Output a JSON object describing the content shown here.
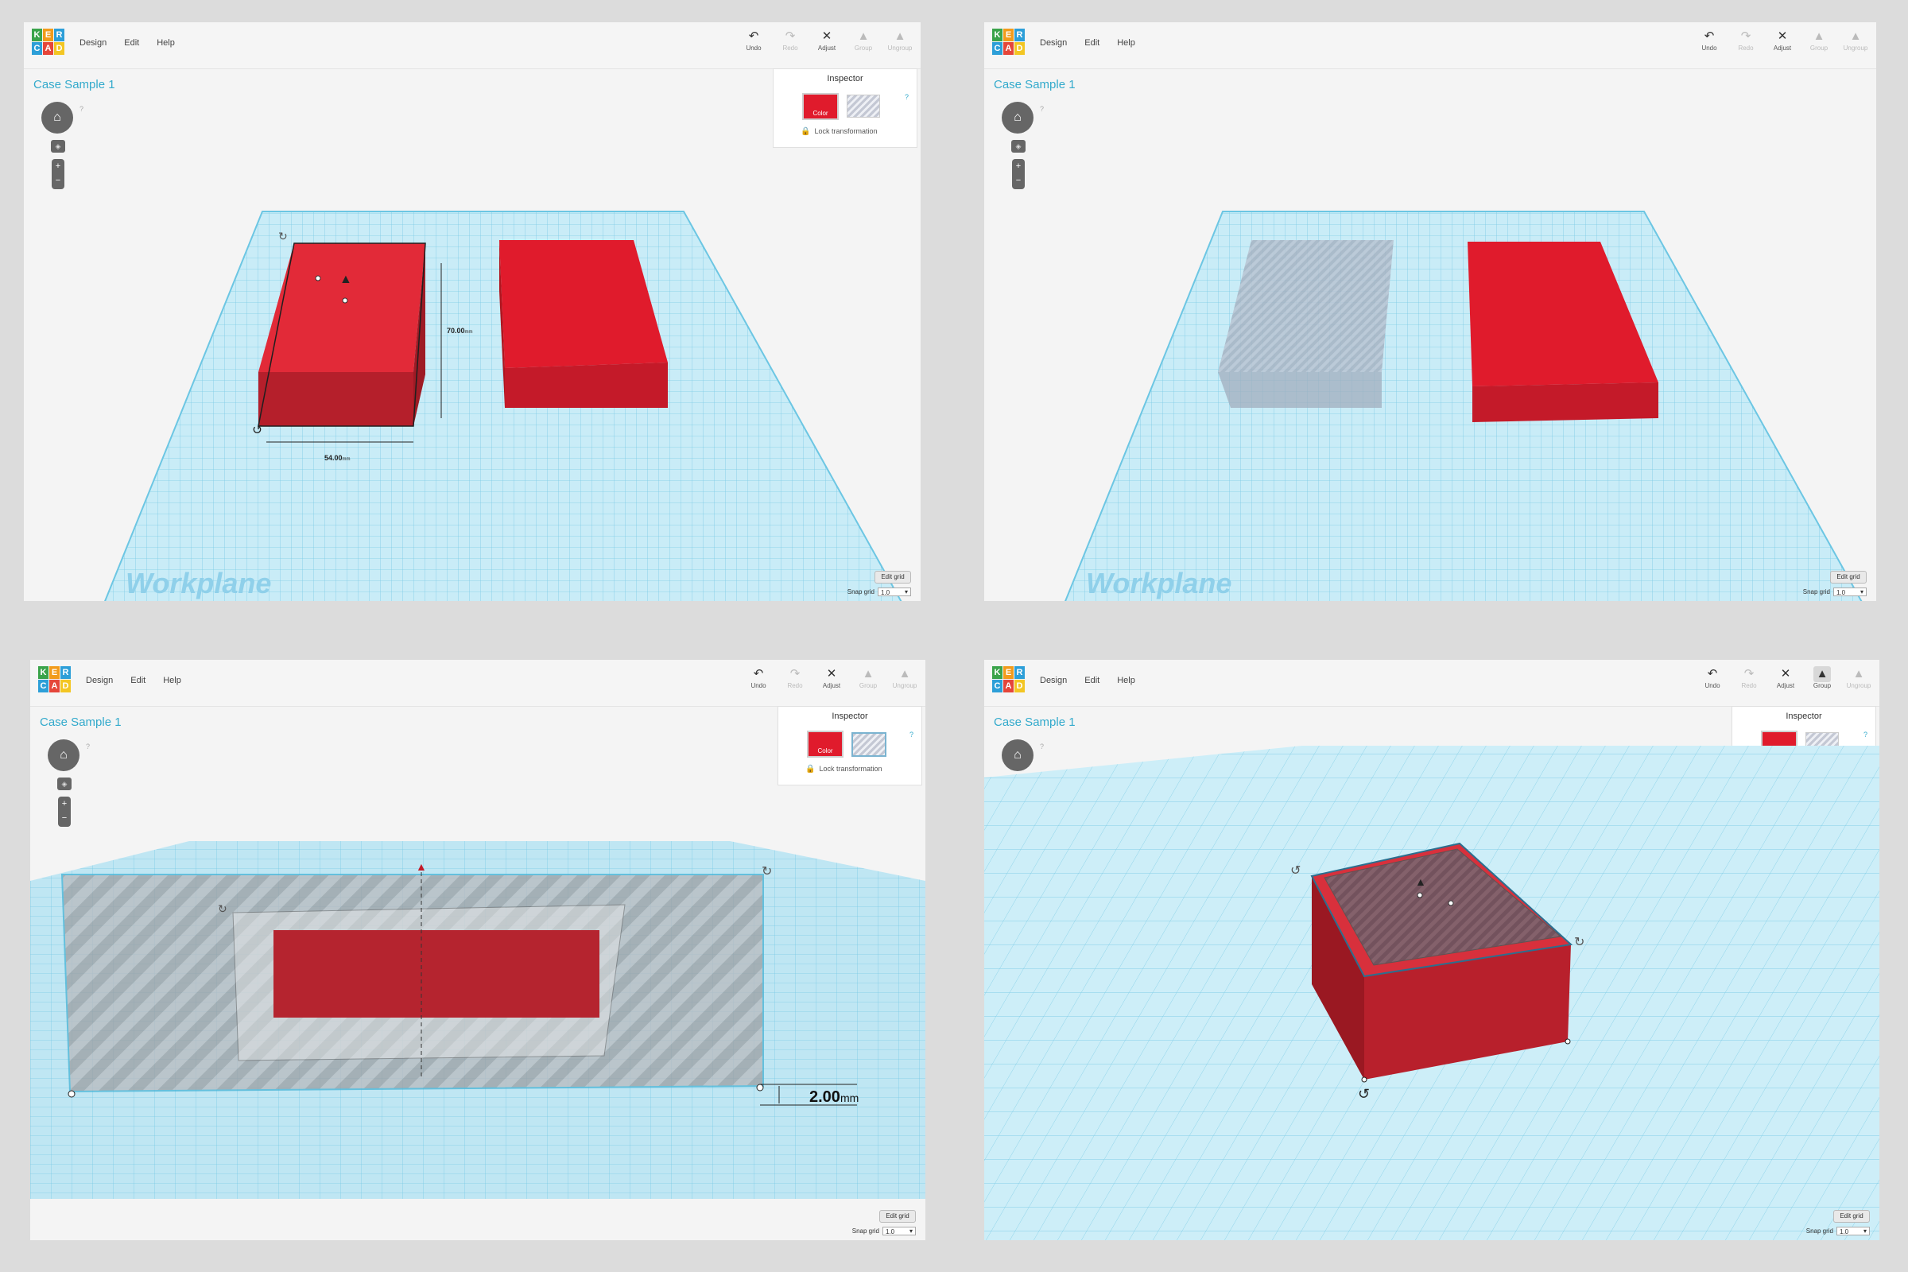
{
  "app": {
    "logo_letters": [
      "K",
      "E",
      "R",
      "C",
      "A",
      "D"
    ],
    "logo_colors": [
      "#3aa34a",
      "#f29b1b",
      "#2d9fd8",
      "#2d9fd8",
      "#e5463a",
      "#f3c623"
    ],
    "menu": [
      "Design",
      "Edit",
      "Help"
    ],
    "toolbar": [
      {
        "label": "Undo",
        "icon": "undo-icon",
        "glyph": "↶",
        "enabled": true
      },
      {
        "label": "Redo",
        "icon": "redo-icon",
        "glyph": "↷",
        "enabled": false
      },
      {
        "label": "Adjust",
        "icon": "adjust-icon",
        "glyph": "✕",
        "enabled": true
      },
      {
        "label": "Group",
        "icon": "group-icon",
        "glyph": "▲",
        "enabled": false
      },
      {
        "label": "Ungroup",
        "icon": "ungroup-icon",
        "glyph": "▲",
        "enabled": false
      }
    ],
    "design_title": "Case Sample 1",
    "nav_help": "?",
    "inspector": {
      "title": "Inspector",
      "color_label": "Color",
      "hole_label": "Hole",
      "help": "?",
      "lock_label": "Lock transformation"
    },
    "edit_grid_label": "Edit grid",
    "snap_grid_label": "Snap grid",
    "snap_grid_value": "1.0",
    "workplane_label": "Workplane",
    "colors": {
      "accent": "#33aacc",
      "solid_red": "#e01b2c",
      "grid": "#bfe6f3",
      "grid_line": "#6cc6e3"
    }
  },
  "panels": [
    {
      "id": "panel-1",
      "inspector_visible": true,
      "group_enabled": false,
      "dimension_width": "54.00",
      "dimension_depth": "70.00",
      "dimension_unit": "mm"
    },
    {
      "id": "panel-2",
      "inspector_visible": false,
      "group_enabled": false
    },
    {
      "id": "panel-3",
      "inspector_visible": true,
      "group_enabled": false,
      "dimension_height": "2.00",
      "dimension_unit": "mm"
    },
    {
      "id": "panel-4",
      "inspector_visible": true,
      "group_enabled": true
    }
  ]
}
